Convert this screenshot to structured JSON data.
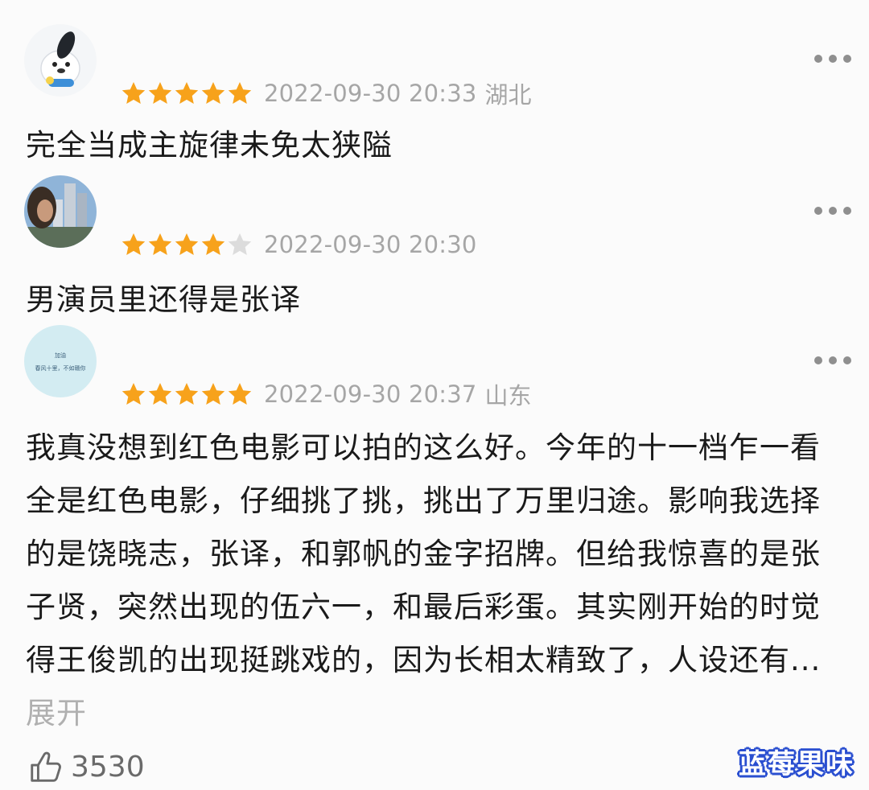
{
  "reviews": [
    {
      "rating": 5,
      "date": "2022-09-30 20:33",
      "location": "湖北",
      "text": "完全当成主旋律未免太狭隘"
    },
    {
      "rating": 4,
      "date": "2022-09-30 20:30",
      "location": "",
      "text": "男演员里还得是张译"
    },
    {
      "rating": 5,
      "date": "2022-09-30 20:37",
      "location": "山东",
      "avatar_text": "加油 春风十里，不如赣你",
      "text": "我真没想到红色电影可以拍的这么好。今年的十一档乍一看全是红色电影，仔细挑了挑，挑出了万里归途。影响我选择的是饶晓志，张译，和郭帆的金字招牌。但给我惊喜的是张子贤，突然出现的伍六一，和最后彩蛋。其实刚开始的时觉得王俊凯的出现挺跳戏的，因为长相太精致了，人设还有...",
      "expand_label": "展开",
      "likes": "3530"
    }
  ],
  "watermark": "蓝莓果味",
  "colors": {
    "star_on": "#f7a21b",
    "star_off": "#dcdcdc",
    "meta": "#a6a6a6"
  },
  "icons": [
    "more-dots-icon",
    "star-icon",
    "thumbs-up-icon"
  ]
}
